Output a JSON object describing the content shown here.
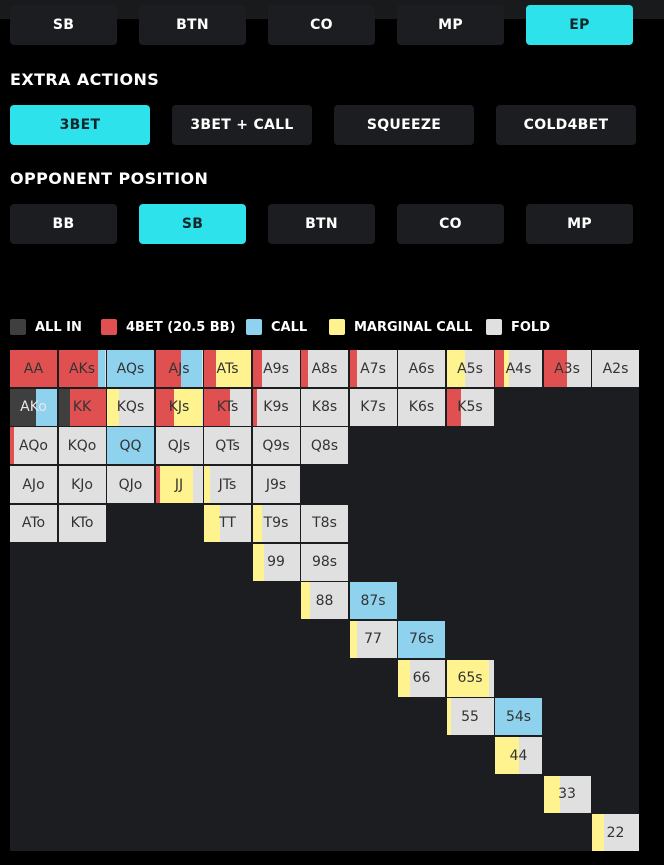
{
  "hero_position": {
    "options": [
      "SB",
      "BTN",
      "CO",
      "MP",
      "EP"
    ],
    "selected": "EP"
  },
  "extra_actions": {
    "title": "EXTRA ACTIONS",
    "options": [
      "3BET",
      "3BET + CALL",
      "SQUEEZE",
      "COLD4BET"
    ],
    "selected": "3BET"
  },
  "opponent_position": {
    "title": "OPPONENT POSITION",
    "options": [
      "BB",
      "SB",
      "BTN",
      "CO",
      "MP"
    ],
    "selected": "SB"
  },
  "colors": {
    "accent": "#2de2ea",
    "button_bg": "#1c1d20",
    "allin": "#3f3f3f",
    "bet": "#e05050",
    "call": "#8fd2ee",
    "marginal": "#fff390",
    "fold": "#e0e0e0"
  },
  "legend": [
    {
      "key": "allin",
      "label": "ALL IN"
    },
    {
      "key": "bet",
      "label": "4BET (20.5 BB)"
    },
    {
      "key": "call",
      "label": "CALL"
    },
    {
      "key": "marginal",
      "label": "MARGINAL CALL"
    },
    {
      "key": "fold",
      "label": "FOLD"
    }
  ],
  "range": [
    [
      {
        "hand": "AA",
        "mix": {
          "bet": 1
        }
      },
      {
        "hand": "AKs",
        "mix": {
          "bet": 0.85,
          "call": 0.15
        }
      },
      {
        "hand": "AQs",
        "mix": {
          "call": 1
        }
      },
      {
        "hand": "AJs",
        "mix": {
          "bet": 0.55,
          "call": 0.45
        }
      },
      {
        "hand": "ATs",
        "mix": {
          "bet": 0.25,
          "marginal": 0.75
        }
      },
      {
        "hand": "A9s",
        "mix": {
          "bet": 0.2,
          "fold": 0.8
        }
      },
      {
        "hand": "A8s",
        "mix": {
          "bet": 0.15,
          "fold": 0.85
        }
      },
      {
        "hand": "A7s",
        "mix": {
          "bet": 0.15,
          "fold": 0.85
        }
      },
      {
        "hand": "A6s",
        "mix": {
          "fold": 1
        }
      },
      {
        "hand": "A5s",
        "mix": {
          "marginal": 0.4,
          "fold": 0.6
        }
      },
      {
        "hand": "A4s",
        "mix": {
          "bet": 0.2,
          "marginal": 0.1,
          "fold": 0.7
        }
      },
      {
        "hand": "A3s",
        "mix": {
          "bet": 0.5,
          "fold": 0.5
        }
      },
      {
        "hand": "A2s",
        "mix": {
          "fold": 1
        }
      }
    ],
    [
      {
        "hand": "AKo",
        "mix": {
          "allin": 0.55,
          "call": 0.45
        }
      },
      {
        "hand": "KK",
        "mix": {
          "allin": 0.25,
          "bet": 0.75
        }
      },
      {
        "hand": "KQs",
        "mix": {
          "marginal": 0.25,
          "fold": 0.75
        }
      },
      {
        "hand": "KJs",
        "mix": {
          "bet": 0.4,
          "marginal": 0.6
        }
      },
      {
        "hand": "KTs",
        "mix": {
          "bet": 0.55,
          "fold": 0.45
        }
      },
      {
        "hand": "K9s",
        "mix": {
          "bet": 0.1,
          "fold": 0.9
        }
      },
      {
        "hand": "K8s",
        "mix": {
          "fold": 1
        }
      },
      {
        "hand": "K7s",
        "mix": {
          "fold": 1
        }
      },
      {
        "hand": "K6s",
        "mix": {
          "fold": 1
        }
      },
      {
        "hand": "K5s",
        "mix": {
          "bet": 0.3,
          "fold": 0.7
        }
      }
    ],
    [
      {
        "hand": "AQo",
        "mix": {
          "bet": 0.08,
          "fold": 0.92
        }
      },
      {
        "hand": "KQo",
        "mix": {
          "fold": 1
        }
      },
      {
        "hand": "QQ",
        "mix": {
          "call": 1
        }
      },
      {
        "hand": "QJs",
        "mix": {
          "fold": 1
        }
      },
      {
        "hand": "QTs",
        "mix": {
          "fold": 1
        }
      },
      {
        "hand": "Q9s",
        "mix": {
          "fold": 1
        }
      },
      {
        "hand": "Q8s",
        "mix": {
          "fold": 1
        }
      }
    ],
    [
      {
        "hand": "AJo",
        "mix": {
          "fold": 1
        }
      },
      {
        "hand": "KJo",
        "mix": {
          "fold": 1
        }
      },
      {
        "hand": "QJo",
        "mix": {
          "fold": 1
        }
      },
      {
        "hand": "JJ",
        "mix": {
          "bet": 0.1,
          "marginal": 0.7,
          "fold": 0.2
        }
      },
      {
        "hand": "JTs",
        "mix": {
          "marginal": 0.12,
          "fold": 0.88
        }
      },
      {
        "hand": "J9s",
        "mix": {
          "fold": 1
        }
      }
    ],
    [
      {
        "hand": "ATo",
        "mix": {
          "fold": 1
        }
      },
      {
        "hand": "KTo",
        "mix": {
          "fold": 1
        }
      },
      null,
      null,
      {
        "hand": "TT",
        "mix": {
          "marginal": 0.35,
          "fold": 0.65
        }
      },
      {
        "hand": "T9s",
        "mix": {
          "marginal": 0.2,
          "fold": 0.8
        }
      },
      {
        "hand": "T8s",
        "mix": {
          "fold": 1
        }
      }
    ],
    [
      null,
      null,
      null,
      null,
      null,
      {
        "hand": "99",
        "mix": {
          "marginal": 0.25,
          "fold": 0.75
        }
      },
      {
        "hand": "98s",
        "mix": {
          "fold": 1
        }
      }
    ],
    [
      null,
      null,
      null,
      null,
      null,
      null,
      {
        "hand": "88",
        "mix": {
          "marginal": 0.2,
          "fold": 0.8
        }
      },
      {
        "hand": "87s",
        "mix": {
          "call": 1
        }
      }
    ],
    [
      null,
      null,
      null,
      null,
      null,
      null,
      null,
      {
        "hand": "77",
        "mix": {
          "marginal": 0.15,
          "fold": 0.85
        }
      },
      {
        "hand": "76s",
        "mix": {
          "call": 1
        }
      }
    ],
    [
      null,
      null,
      null,
      null,
      null,
      null,
      null,
      null,
      {
        "hand": "66",
        "mix": {
          "marginal": 0.25,
          "fold": 0.75
        }
      },
      {
        "hand": "65s",
        "mix": {
          "marginal": 0.9,
          "fold": 0.1
        }
      }
    ],
    [
      null,
      null,
      null,
      null,
      null,
      null,
      null,
      null,
      null,
      {
        "hand": "55",
        "mix": {
          "marginal": 0.1,
          "fold": 0.9
        }
      },
      {
        "hand": "54s",
        "mix": {
          "call": 1
        }
      }
    ],
    [
      null,
      null,
      null,
      null,
      null,
      null,
      null,
      null,
      null,
      null,
      {
        "hand": "44",
        "mix": {
          "marginal": 0.5,
          "fold": 0.5
        }
      }
    ],
    [
      null,
      null,
      null,
      null,
      null,
      null,
      null,
      null,
      null,
      null,
      null,
      {
        "hand": "33",
        "mix": {
          "marginal": 0.35,
          "fold": 0.65
        }
      }
    ],
    [
      null,
      null,
      null,
      null,
      null,
      null,
      null,
      null,
      null,
      null,
      null,
      null,
      {
        "hand": "22",
        "mix": {
          "marginal": 0.25,
          "fold": 0.75
        }
      }
    ]
  ]
}
